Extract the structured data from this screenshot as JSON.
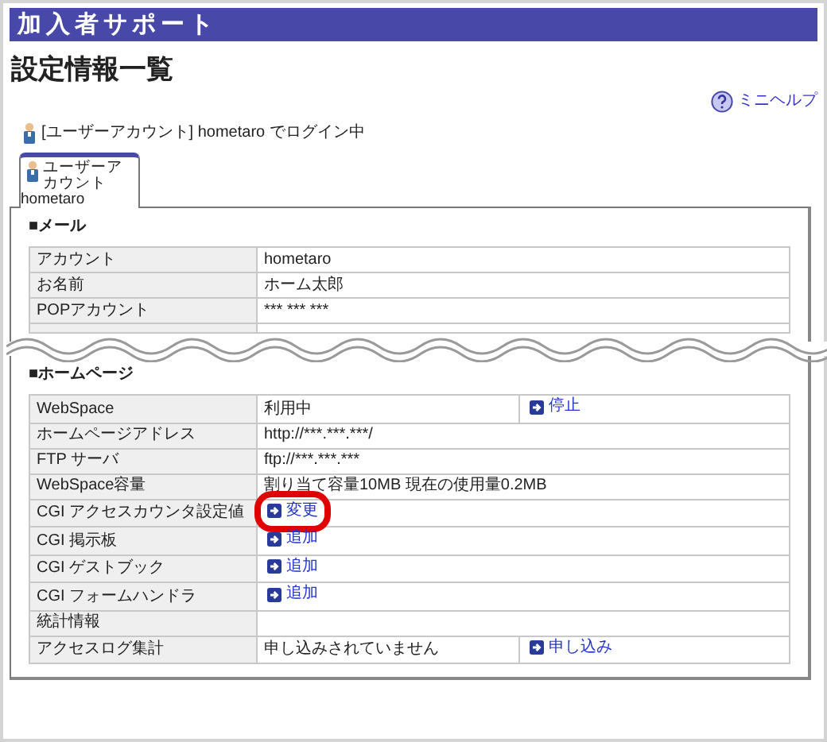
{
  "header": {
    "title": "加入者サポート"
  },
  "page_title": "設定情報一覧",
  "help_link": "ミニヘルプ",
  "login_status": "[ユーザーアカウント] hometaro でログイン中",
  "tabs": [
    {
      "label": "ユーザーアカウント",
      "user": "hometaro",
      "selected": true
    }
  ],
  "sections": [
    {
      "heading": "■メール",
      "truncated": true,
      "rows": [
        {
          "kind": "text",
          "label": "アカウント",
          "value": "hometaro"
        },
        {
          "kind": "text",
          "label": "お名前",
          "value": "ホーム太郎"
        },
        {
          "kind": "text",
          "label": "POPアカウント",
          "value": "*** *** ***"
        }
      ]
    },
    {
      "heading": "■ホームページ",
      "truncated": false,
      "rows": [
        {
          "kind": "text_action",
          "label": "WebSpace",
          "value": "利用中",
          "action": "停止",
          "highlighted": false
        },
        {
          "kind": "text",
          "label": "ホームページアドレス",
          "value": "http://***.***.***/"
        },
        {
          "kind": "text",
          "label": "FTP サーバ",
          "value": "ftp://***.***.***"
        },
        {
          "kind": "text",
          "label": "WebSpace容量",
          "value": "割り当て容量10MB 現在の使用量0.2MB"
        },
        {
          "kind": "action",
          "label": "CGI アクセスカウンタ設定値",
          "action": "変更",
          "highlighted": true
        },
        {
          "kind": "action",
          "label": "CGI 掲示板",
          "action": "追加",
          "highlighted": false
        },
        {
          "kind": "action",
          "label": "CGI ゲストブック",
          "action": "追加",
          "highlighted": false
        },
        {
          "kind": "action",
          "label": "CGI フォームハンドラ",
          "action": "追加",
          "highlighted": false
        },
        {
          "kind": "text",
          "label": "統計情報",
          "value": ""
        },
        {
          "kind": "text_action",
          "label": "アクセスログ集計",
          "value": "申し込みされていません",
          "action": "申し込み",
          "highlighted": false
        }
      ]
    }
  ]
}
